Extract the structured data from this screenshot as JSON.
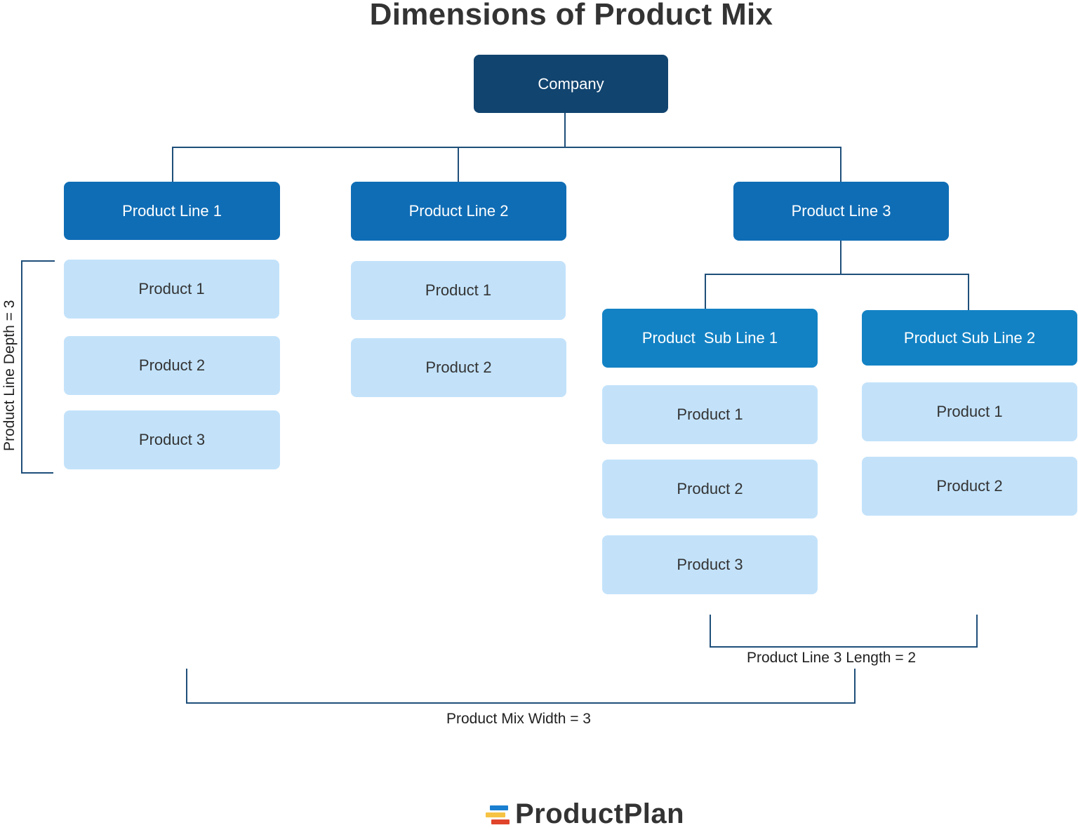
{
  "title": "Dimensions of Product Mix",
  "colors": {
    "company": "#11446f",
    "product_line": "#0f6db5",
    "sub_line": "#1382c4",
    "product": "#c3e2fa",
    "connector": "#1f4f7a",
    "text_dark": "#333333"
  },
  "company": {
    "label": "Company"
  },
  "product_lines": [
    {
      "label": "Product Line 1",
      "products": [
        "Product 1",
        "Product 2",
        "Product 3"
      ]
    },
    {
      "label": "Product Line 2",
      "products": [
        "Product 1",
        "Product 2"
      ]
    },
    {
      "label": "Product Line 3",
      "sub_lines": [
        {
          "label": "Product  Sub Line 1",
          "products": [
            "Product 1",
            "Product 2",
            "Product 3"
          ]
        },
        {
          "label": "Product Sub Line 2",
          "products": [
            "Product 1",
            "Product 2"
          ]
        }
      ]
    }
  ],
  "annotations": {
    "depth": "Product Line Depth = 3",
    "length": "Product Line 3 Length = 2",
    "width": "Product Mix Width = 3"
  },
  "logo": {
    "text": "ProductPlan",
    "bar_colors": [
      "#1a7fd0",
      "#f6c344",
      "#e0452b"
    ]
  }
}
